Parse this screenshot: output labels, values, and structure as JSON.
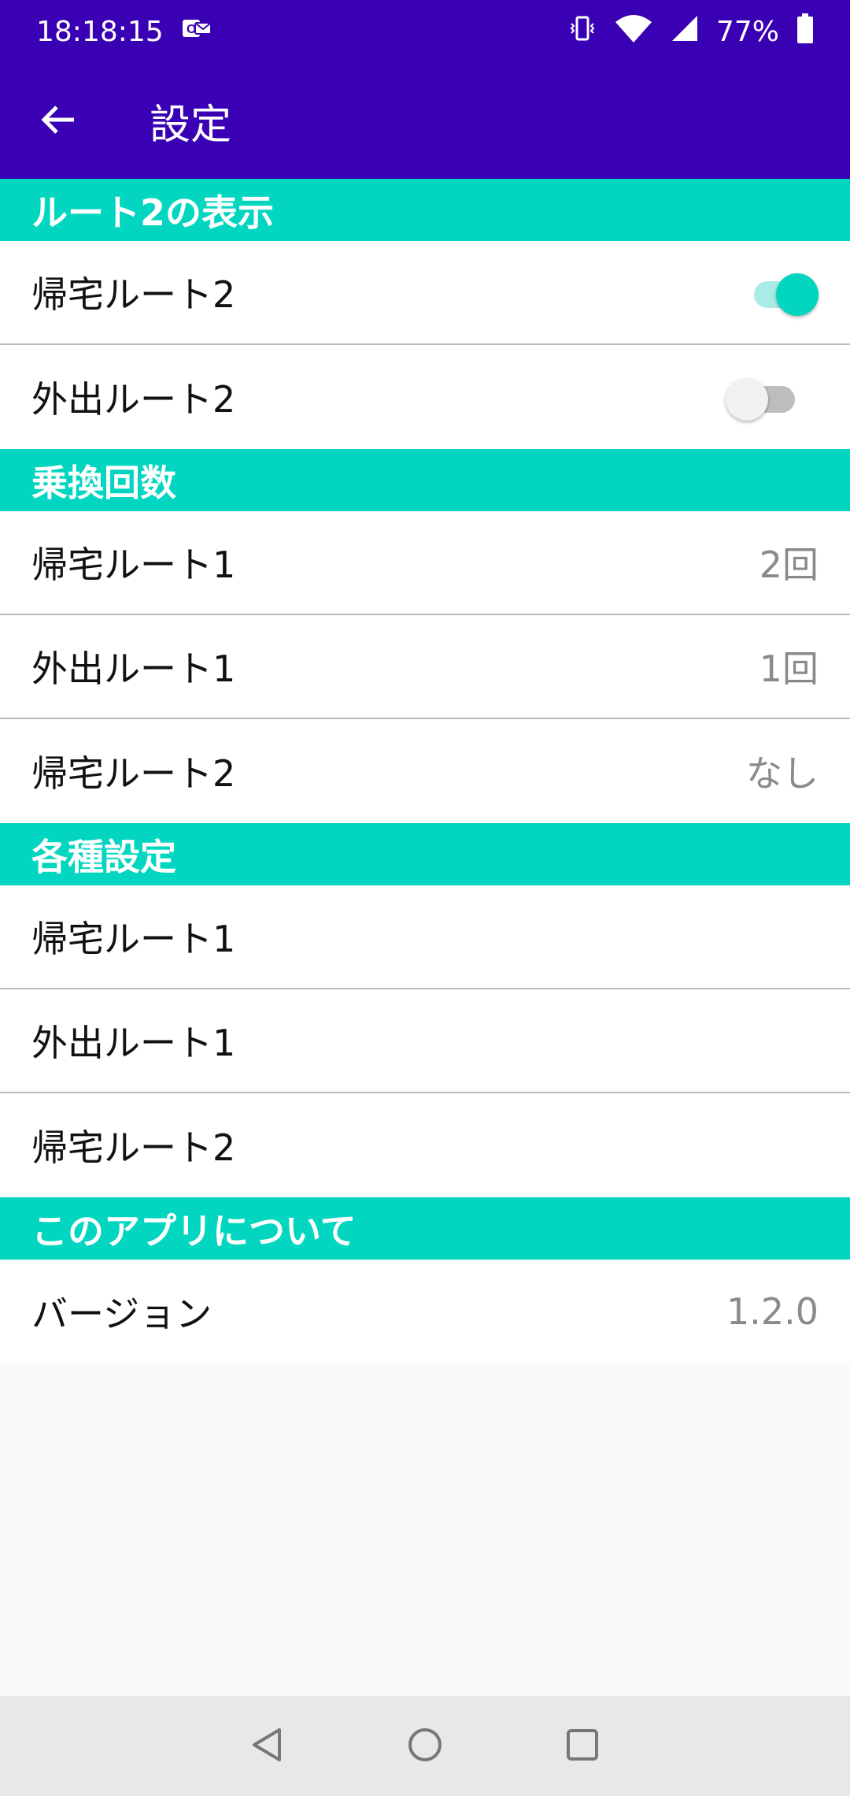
{
  "status_bar": {
    "time": "18:18:15",
    "battery": "77%"
  },
  "app_bar": {
    "title": "設定"
  },
  "sections": {
    "route2_display": {
      "header": "ルート2の表示",
      "items": [
        {
          "label": "帰宅ルート2",
          "toggle": "on"
        },
        {
          "label": "外出ルート2",
          "toggle": "off"
        }
      ]
    },
    "transfers": {
      "header": "乗換回数",
      "items": [
        {
          "label": "帰宅ルート1",
          "value": "2回"
        },
        {
          "label": "外出ルート1",
          "value": "1回"
        },
        {
          "label": "帰宅ルート2",
          "value": "なし"
        }
      ]
    },
    "settings": {
      "header": "各種設定",
      "items": [
        {
          "label": "帰宅ルート1"
        },
        {
          "label": "外出ルート1"
        },
        {
          "label": "帰宅ルート2"
        }
      ]
    },
    "about": {
      "header": "このアプリについて",
      "items": [
        {
          "label": "バージョン",
          "value": "1.2.0"
        }
      ]
    }
  },
  "colors": {
    "primary": "#3a00b4",
    "accent": "#03d6c0"
  },
  "icons": {
    "back": "arrow-left-icon",
    "vibrate": "vibrate-icon",
    "wifi": "wifi-icon",
    "signal": "signal-icon",
    "battery": "battery-icon",
    "notification": "mail-notification-icon"
  }
}
